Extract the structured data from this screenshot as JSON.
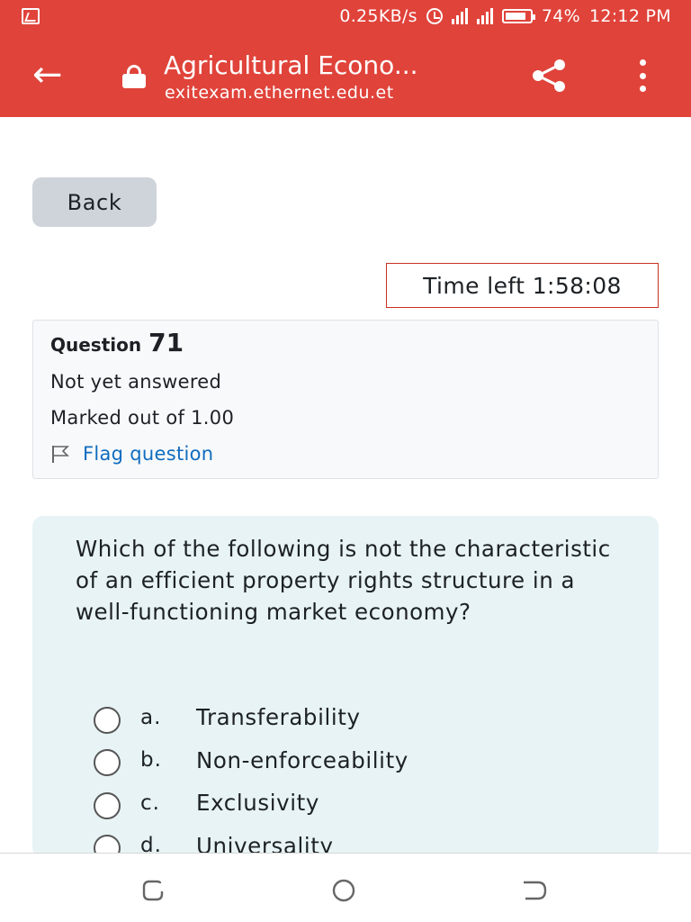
{
  "status_bar": {
    "network_speed": "0.25KB/s",
    "battery": "74%",
    "time": "12:12 PM"
  },
  "browser": {
    "title": "Agricultural Econo...",
    "url": "exitexam.ethernet.edu.et"
  },
  "page": {
    "back_label": "Back",
    "timer": "Time left 1:58:08"
  },
  "question_info": {
    "label": "Question",
    "number": "71",
    "state": "Not yet answered",
    "grade": "Marked out of 1.00",
    "flag_label": "Flag question"
  },
  "question": {
    "text": "Which of the following is not the characteristic of an efficient property rights structure in a well-functioning market economy?",
    "options": [
      {
        "letter": "a.",
        "text": "Transferability"
      },
      {
        "letter": "b.",
        "text": "Non-enforceability"
      },
      {
        "letter": "c.",
        "text": "Exclusivity"
      },
      {
        "letter": "d.",
        "text": "Universality"
      }
    ]
  },
  "icons": {
    "header_back": "arrow-left-icon",
    "secure": "lock-icon",
    "share": "share-icon",
    "menu": "more-vert-icon",
    "flag": "flag-icon",
    "nav": [
      "recent-apps-icon",
      "home-icon",
      "back-icon"
    ]
  },
  "colors": {
    "appbar": "#e0433a",
    "timer_border": "#ca3120",
    "link": "#0f6cbf",
    "question_bg": "#e7f3f5"
  }
}
